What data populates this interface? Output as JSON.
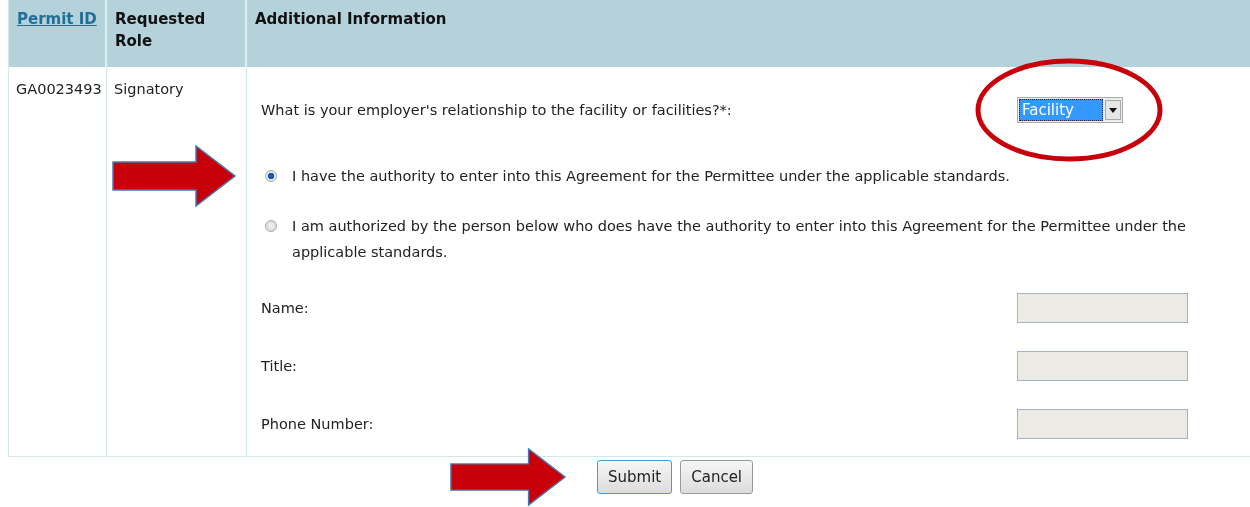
{
  "table": {
    "columns": [
      {
        "label": "Permit ID",
        "kind": "link"
      },
      {
        "label": "Requested Role",
        "kind": "text"
      },
      {
        "label": "Additional Information",
        "kind": "text"
      }
    ],
    "row": {
      "permit_id": "GA0023493",
      "requested_role": "Signatory",
      "question": "What is your employer's relationship to the facility or facilities?*:",
      "relationship_select": {
        "value": "Facility"
      },
      "options": [
        {
          "label": "I have the authority to enter into this Agreement for the Permittee under the applicable standards.",
          "selected": true
        },
        {
          "label": "I am authorized by the person below who does have the authority to enter into this Agreement for the Permittee under the applicable standards.",
          "selected": false
        }
      ],
      "fields": [
        {
          "label": "Name:"
        },
        {
          "label": "Title:"
        },
        {
          "label": "Phone Number:"
        }
      ]
    }
  },
  "buttons": [
    {
      "label": "Submit",
      "focused": true
    },
    {
      "label": "Cancel",
      "focused": false
    }
  ]
}
